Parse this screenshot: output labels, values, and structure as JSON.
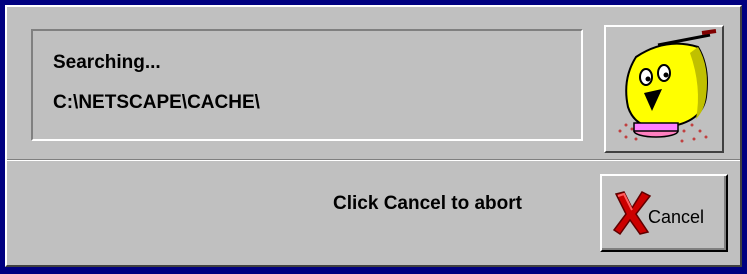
{
  "status": {
    "line1": "Searching...",
    "line2": "C:\\NETSCAPE\\CACHE\\"
  },
  "mascot": {
    "icon": "smiling-cleaner-mascot-icon"
  },
  "footer": {
    "prompt": "Click Cancel to abort",
    "cancel_label": "Cancel",
    "cancel_icon": "red-x-icon"
  },
  "colors": {
    "window_frame": "#000080",
    "dialog_bg": "#c0c0c0",
    "mascot_yellow": "#ffff00",
    "cancel_x_red": "#cc0000"
  }
}
